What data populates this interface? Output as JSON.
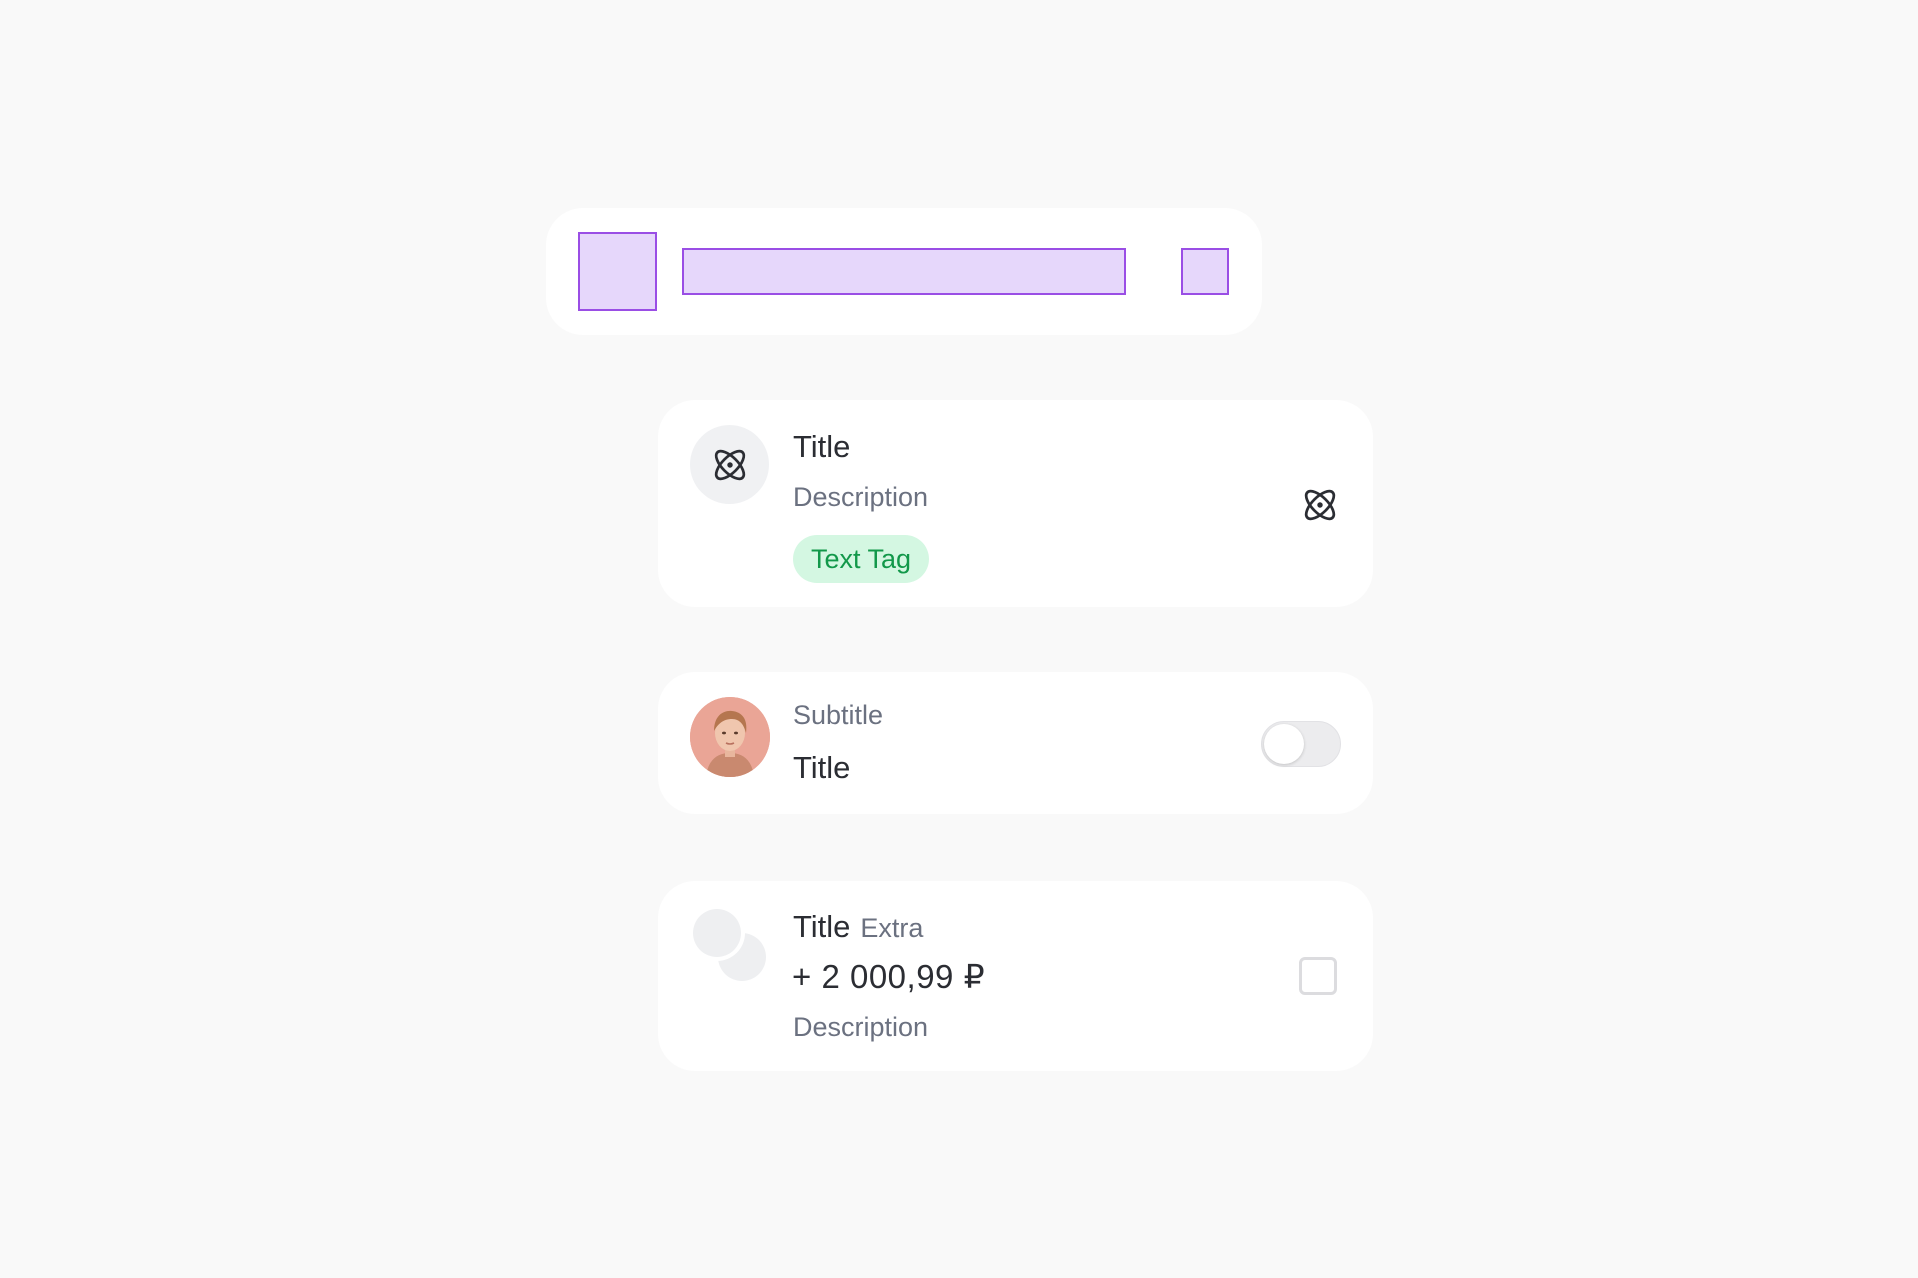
{
  "cell_card_1": {
    "title": "Title",
    "description": "Description",
    "tag": "Text Tag",
    "left_icon": "atom-icon",
    "right_icon": "atom-icon"
  },
  "cell_card_2": {
    "subtitle": "Subtitle",
    "title": "Title",
    "avatar": "avatar",
    "toggle_on": false
  },
  "cell_card_3": {
    "title": "Title",
    "extra": "Extra",
    "amount": "+ 2 000,99 ₽",
    "description": "Description",
    "checkbox_checked": false
  },
  "colors": {
    "background": "#f9f9f9",
    "card": "#ffffff",
    "slot_fill": "#e6d7fb",
    "slot_border": "#9a4ee5",
    "tag_bg": "#d4f7e2",
    "tag_text": "#12984a",
    "text_primary": "#2b2d33",
    "text_secondary": "#6b7180"
  }
}
